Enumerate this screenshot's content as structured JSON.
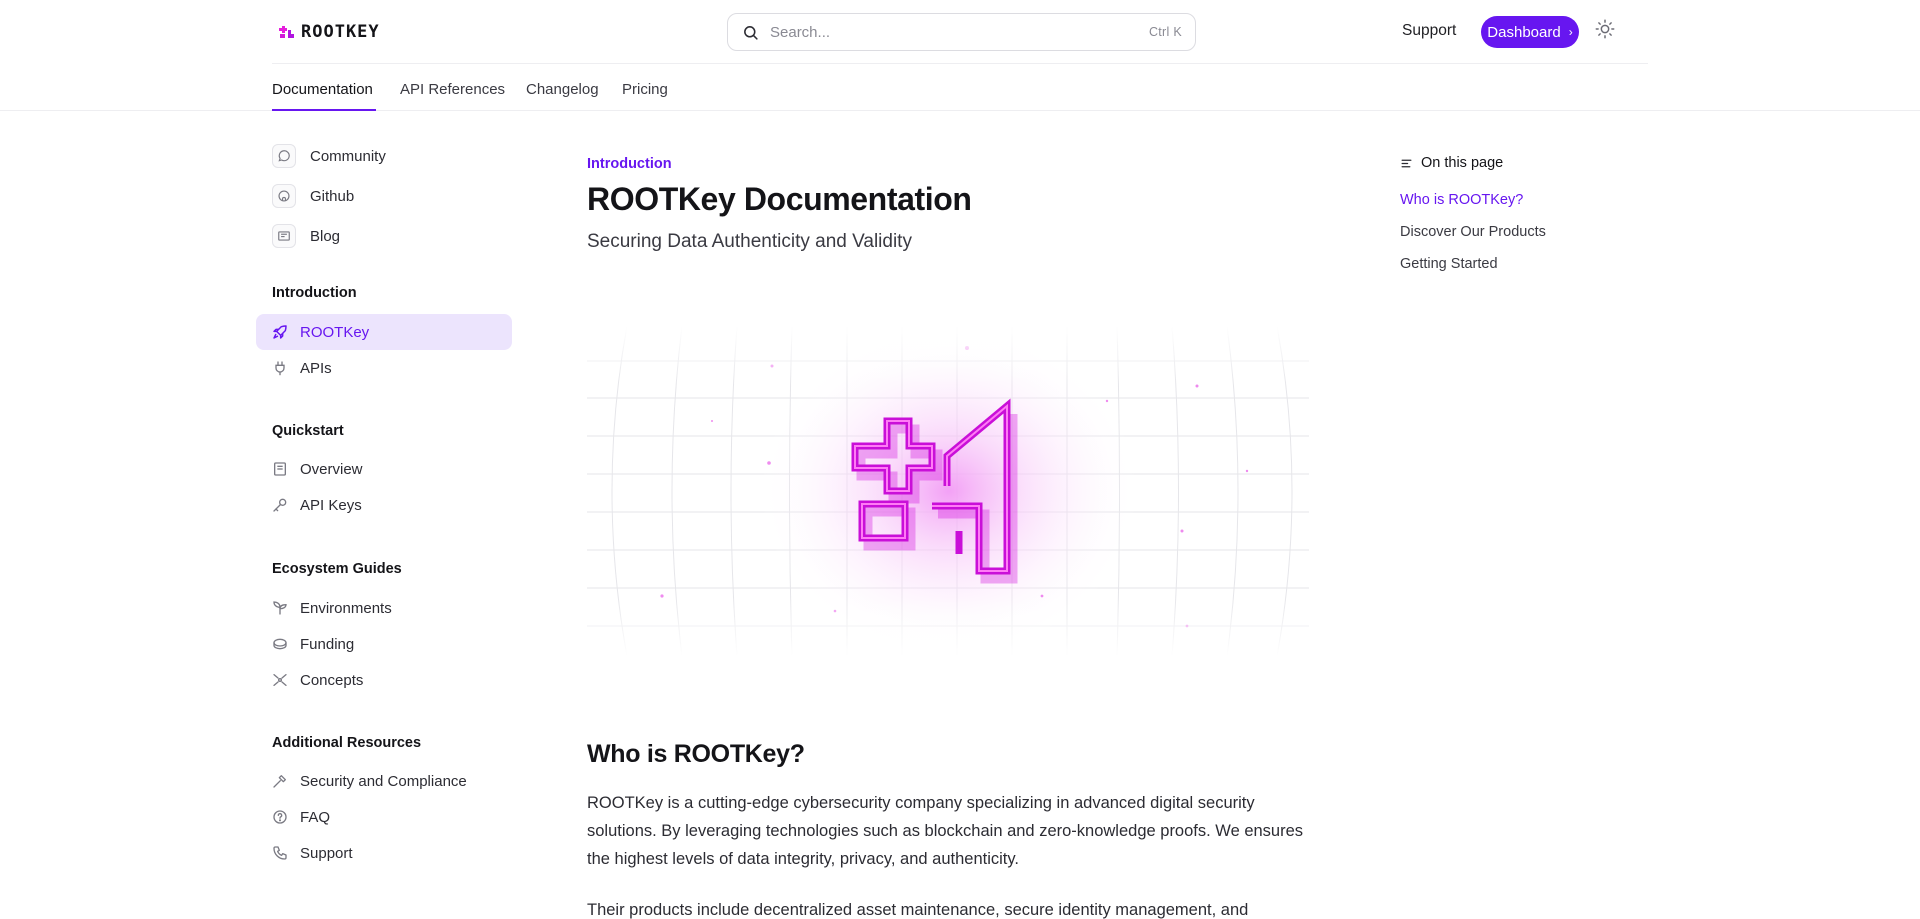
{
  "brand": {
    "name": "ROOTKEY",
    "accent": "#6716f0"
  },
  "header": {
    "search_placeholder": "Search...",
    "search_shortcut": "Ctrl K",
    "support_label": "Support",
    "dashboard_label": "Dashboard",
    "dashboard_icon": "chevron-right-icon",
    "theme_icon": "sun-icon"
  },
  "tabs": [
    {
      "label": "Documentation",
      "active": true
    },
    {
      "label": "API References",
      "active": false
    },
    {
      "label": "Changelog",
      "active": false
    },
    {
      "label": "Pricing",
      "active": false
    }
  ],
  "sidebar": {
    "links": [
      {
        "label": "Community",
        "icon": "whatsapp-icon"
      },
      {
        "label": "Github",
        "icon": "github-icon"
      },
      {
        "label": "Blog",
        "icon": "newspaper-icon"
      }
    ],
    "sections": [
      {
        "heading": "Introduction",
        "items": [
          {
            "label": "ROOTKey",
            "icon": "rocket-icon",
            "active": true
          },
          {
            "label": "APIs",
            "icon": "plug-icon",
            "active": false
          }
        ]
      },
      {
        "heading": "Quickstart",
        "items": [
          {
            "label": "Overview",
            "icon": "document-icon",
            "active": false
          },
          {
            "label": "API Keys",
            "icon": "key-icon",
            "active": false
          }
        ]
      },
      {
        "heading": "Ecosystem Guides",
        "items": [
          {
            "label": "Environments",
            "icon": "sprout-icon",
            "active": false
          },
          {
            "label": "Funding",
            "icon": "coins-icon",
            "active": false
          },
          {
            "label": "Concepts",
            "icon": "network-icon",
            "active": false
          }
        ]
      },
      {
        "heading": "Additional Resources",
        "items": [
          {
            "label": "Security and Compliance",
            "icon": "hammer-icon",
            "active": false
          },
          {
            "label": "FAQ",
            "icon": "help-circle-icon",
            "active": false
          },
          {
            "label": "Support",
            "icon": "phone-icon",
            "active": false
          }
        ]
      }
    ]
  },
  "main": {
    "eyebrow": "Introduction",
    "title": "ROOTKey Documentation",
    "subtitle": "Securing Data Authenticity and Validity",
    "section_title": "Who is ROOTKey?",
    "paragraphs": [
      "ROOTKey is a cutting-edge cybersecurity company specializing in advanced digital security solutions. By leveraging technologies such as blockchain and zero-knowledge proofs. We ensures the highest levels of data integrity, privacy, and authenticity.",
      "Their products include decentralized asset maintenance, secure identity management, and"
    ]
  },
  "toc": {
    "title": "On this page",
    "items": [
      {
        "label": "Who is ROOTKey?",
        "active": true
      },
      {
        "label": "Discover Our Products",
        "active": false
      },
      {
        "label": "Getting Started",
        "active": false
      }
    ]
  }
}
